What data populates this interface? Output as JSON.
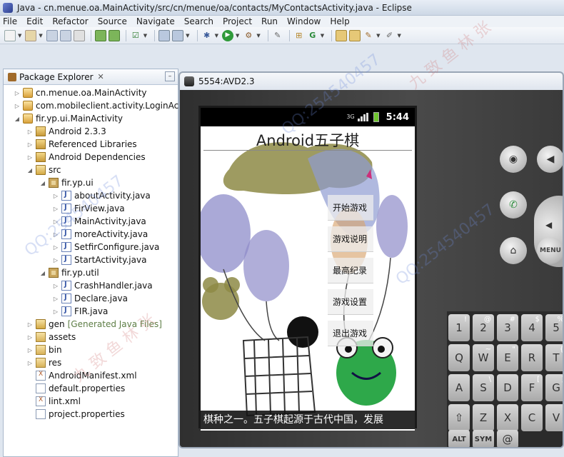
{
  "window": {
    "title": "Java - cn.menue.oa.MainActivity/src/cn/menue/oa/contacts/MyContactsActivity.java - Eclipse"
  },
  "menu": [
    "File",
    "Edit",
    "Refactor",
    "Source",
    "Navigate",
    "Search",
    "Project",
    "Run",
    "Window",
    "Help"
  ],
  "explorer": {
    "tab_label": "Package Explorer",
    "close_glyph": "✕",
    "tree": [
      {
        "label": "cn.menue.oa.MainActivity",
        "note": ""
      },
      {
        "label": "com.mobileclient.activity.LoginActivity",
        "note": ""
      },
      {
        "label": "fir.yp.ui.MainActivity",
        "note": ""
      },
      {
        "label": "Android 2.3.3",
        "note": ""
      },
      {
        "label": "Referenced Libraries",
        "note": ""
      },
      {
        "label": "Android Dependencies",
        "note": ""
      },
      {
        "label": "src",
        "note": ""
      },
      {
        "label": "fir.yp.ui",
        "note": ""
      },
      {
        "label": "aboutActivity.java",
        "note": ""
      },
      {
        "label": "FirView.java",
        "note": ""
      },
      {
        "label": "MainActivity.java",
        "note": ""
      },
      {
        "label": "moreActivity.java",
        "note": ""
      },
      {
        "label": "SetfirConfigure.java",
        "note": ""
      },
      {
        "label": "StartActivity.java",
        "note": ""
      },
      {
        "label": "fir.yp.util",
        "note": ""
      },
      {
        "label": "CrashHandler.java",
        "note": ""
      },
      {
        "label": "Declare.java",
        "note": ""
      },
      {
        "label": "FIR.java",
        "note": ""
      },
      {
        "label": "gen",
        "note": "[Generated Java Files]"
      },
      {
        "label": "assets",
        "note": ""
      },
      {
        "label": "bin",
        "note": ""
      },
      {
        "label": "res",
        "note": ""
      },
      {
        "label": "AndroidManifest.xml",
        "note": ""
      },
      {
        "label": "default.properties",
        "note": ""
      },
      {
        "label": "lint.xml",
        "note": ""
      },
      {
        "label": "project.properties",
        "note": ""
      }
    ]
  },
  "emulator": {
    "title": "5554:AVD2.3",
    "status": {
      "network": "3G",
      "time": "5:44"
    },
    "app_title": "Android五子棋",
    "menu_buttons": [
      "开始游戏",
      "游戏说明",
      "最高纪录",
      "游戏设置",
      "退出游戏"
    ],
    "ticker": "棋种之一。五子棋起源于古代中国，发展",
    "hw_buttons": {
      "menu": "MENU"
    },
    "keyboard": {
      "row1": [
        {
          "k": "1",
          "s": "!"
        },
        {
          "k": "2",
          "s": "@"
        },
        {
          "k": "3",
          "s": "#"
        },
        {
          "k": "4",
          "s": "$"
        },
        {
          "k": "5",
          "s": "%"
        }
      ],
      "row2": [
        {
          "k": "Q",
          "s": ""
        },
        {
          "k": "W",
          "s": "~"
        },
        {
          "k": "E",
          "s": "\""
        },
        {
          "k": "R",
          "s": ""
        },
        {
          "k": "T",
          "s": "{"
        }
      ],
      "row3": [
        {
          "k": "A",
          "s": ""
        },
        {
          "k": "S",
          "s": "\\"
        },
        {
          "k": "D",
          "s": ""
        },
        {
          "k": "F",
          "s": "["
        },
        {
          "k": "G",
          "s": "]"
        }
      ],
      "row4": [
        {
          "k": "⇧",
          "s": ""
        },
        {
          "k": "Z",
          "s": ""
        },
        {
          "k": "X",
          "s": ""
        },
        {
          "k": "C",
          "s": ""
        },
        {
          "k": "V",
          "s": ""
        }
      ],
      "row5": [
        {
          "k": "ALT",
          "s": ""
        },
        {
          "k": "SYM",
          "s": ""
        },
        {
          "k": "@",
          "s": ""
        }
      ]
    }
  },
  "watermark": {
    "qq": "QQ:254540457",
    "name": "九 致 鱼 林 张"
  }
}
